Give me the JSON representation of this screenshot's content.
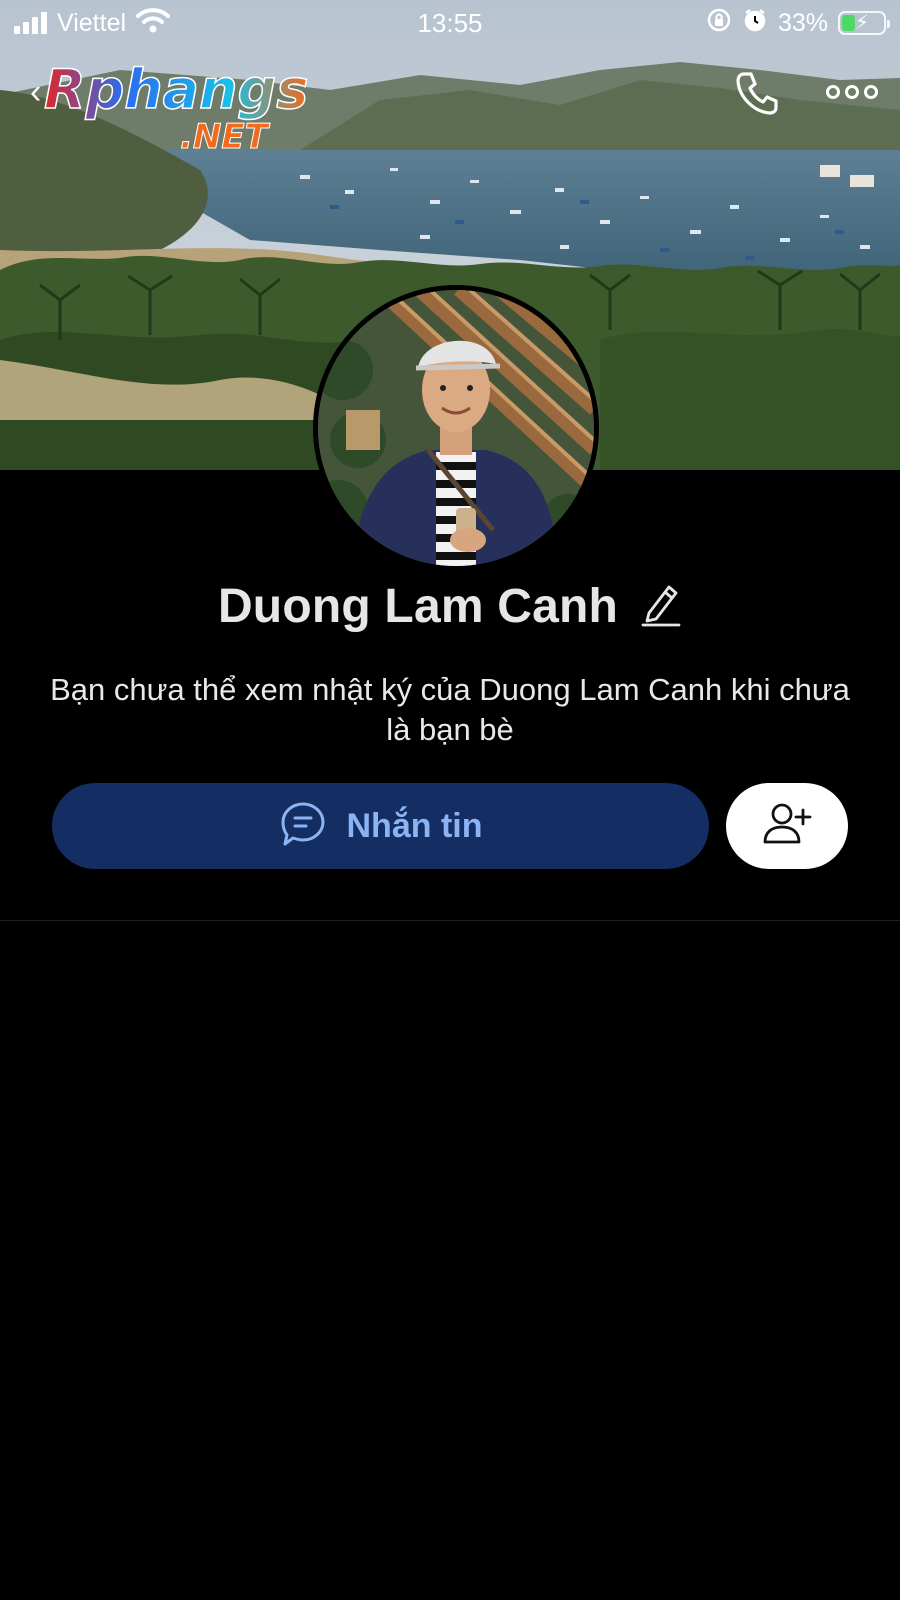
{
  "status_bar": {
    "carrier": "Viettel",
    "time": "13:55",
    "battery_percent": "33%",
    "battery_level": 0.33,
    "icons": [
      "signal-icon",
      "wifi-icon",
      "orientation-lock-icon",
      "alarm-icon",
      "battery-charging-icon"
    ]
  },
  "header": {
    "back_icon": "chevron-left-icon",
    "call_icon": "phone-icon",
    "more_icon": "more-dots-icon"
  },
  "watermark": {
    "brand": "Rphangs",
    "suffix": ".NET"
  },
  "profile": {
    "name": "Duong Lam Canh",
    "edit_icon": "pencil-icon",
    "privacy_notice": "Bạn chưa thể xem nhật ký của Duong Lam Canh khi chưa là bạn bè"
  },
  "actions": {
    "message_label": "Nhắn tin",
    "message_icon": "chat-bubble-icon",
    "add_friend_icon": "add-user-icon"
  },
  "colors": {
    "background": "#000000",
    "message_button_bg": "#142d63",
    "message_button_text": "#8cb4f5",
    "add_friend_bg": "#ffffff",
    "battery_fill": "#4cd964"
  }
}
